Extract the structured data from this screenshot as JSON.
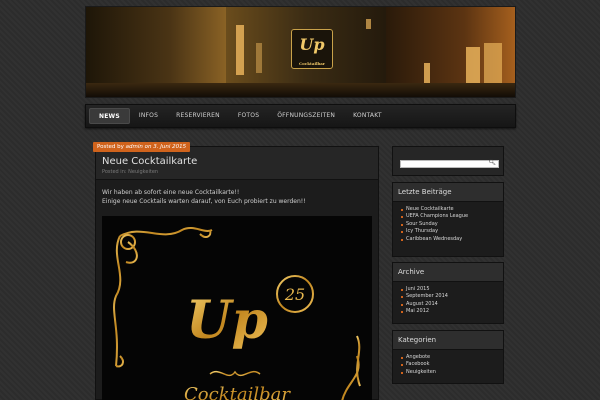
{
  "banner": {
    "sign_main": "Up",
    "sign_sub": "Cocktailbar"
  },
  "nav": {
    "items": [
      "NEWS",
      "INFOS",
      "RESERVIEREN",
      "FOTOS",
      "ÖFFNUNGSZEITEN",
      "KONTAKT"
    ],
    "active": "NEWS"
  },
  "post": {
    "meta_prefix": "Posted by",
    "author": "admin",
    "meta_on": "on",
    "date": "3. Juni 2015",
    "title": "Neue Cocktailkarte",
    "category_line": "Posted in: Neuigkeiten",
    "body_line1": "Wir haben ab sofort eine neue Cocktailkarte!!",
    "body_line2": "Einige neue Cocktails warten darauf, von Euch probiert zu werden!!",
    "poster_logo": "Up",
    "poster_number": "25",
    "poster_subtitle": "Cocktailbar"
  },
  "sidebar": {
    "search_icon": "search-icon",
    "recent": {
      "title": "Letzte Beiträge",
      "items": [
        "Neue Cocktailkarte",
        "UEFA Champions League",
        "Sour Sunday",
        "Icy Thursday",
        "Caribbean Wednesday"
      ]
    },
    "archive": {
      "title": "Archive",
      "items": [
        "Juni 2015",
        "September 2014",
        "August 2014",
        "Mai 2012"
      ]
    },
    "categories": {
      "title": "Kategorien",
      "items": [
        "Angebote",
        "Facebook",
        "Neuigkeiten"
      ]
    }
  },
  "colors": {
    "accent": "#d0631c",
    "gold": "#d9a641",
    "background": "#2c2c2c"
  }
}
